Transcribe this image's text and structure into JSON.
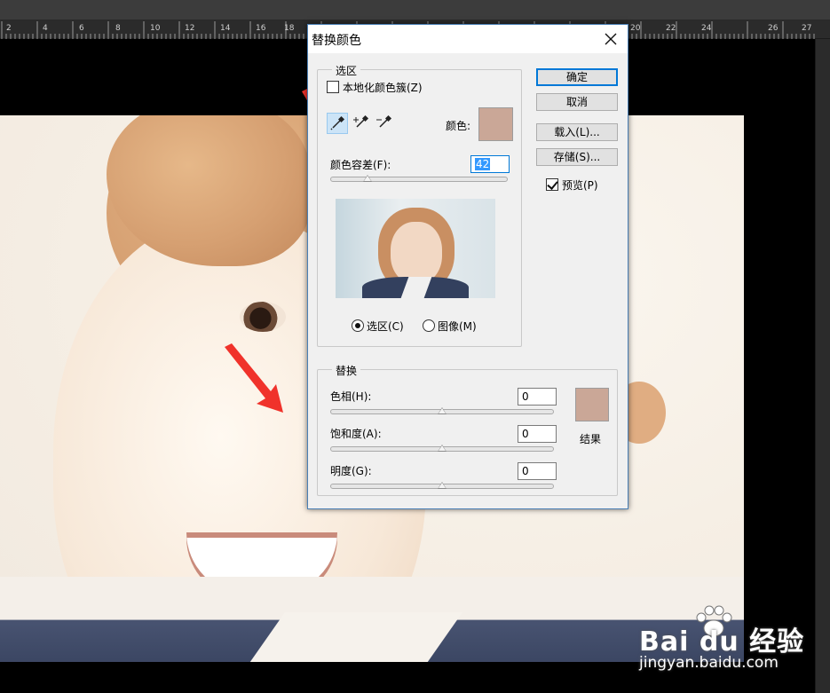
{
  "ruler": {
    "numbers": [
      "2",
      "4",
      "6",
      "8",
      "10",
      "12",
      "14",
      "16",
      "18",
      "20",
      "22",
      "24",
      "26",
      "27"
    ]
  },
  "dialog": {
    "title": "替换颜色",
    "close_icon": "close-icon",
    "selection": {
      "group_label": "选区",
      "localized_clusters_label": "本地化颜色簇(Z)",
      "localized_clusters_checked": false,
      "tools": [
        "eyedropper-icon",
        "eyedropper-plus-icon",
        "eyedropper-minus-icon"
      ],
      "color_label": "颜色:",
      "color_hex": "#caa797",
      "fuzziness_label": "颜色容差(F):",
      "fuzziness_value": "42",
      "fuzziness_level": 0.21,
      "radio_selection_label": "选区(C)",
      "radio_image_label": "图像(M)",
      "radio_selected": "selection"
    },
    "replacement": {
      "group_label": "替换",
      "hue_label": "色相(H):",
      "hue_value": "0",
      "saturation_label": "饱和度(A):",
      "saturation_value": "0",
      "lightness_label": "明度(G):",
      "lightness_value": "0",
      "result_label": "结果",
      "result_hex": "#caa797"
    },
    "buttons": {
      "ok": "确定",
      "cancel": "取消",
      "load": "载入(L)...",
      "save": "存储(S)..."
    },
    "preview_label": "预览(P)",
    "preview_checked": true
  },
  "watermark": {
    "logo": "Bai du 经验",
    "url": "jingyan.baidu.com"
  },
  "colors": {
    "accent": "#0078d7",
    "arrow": "#f0322b"
  }
}
